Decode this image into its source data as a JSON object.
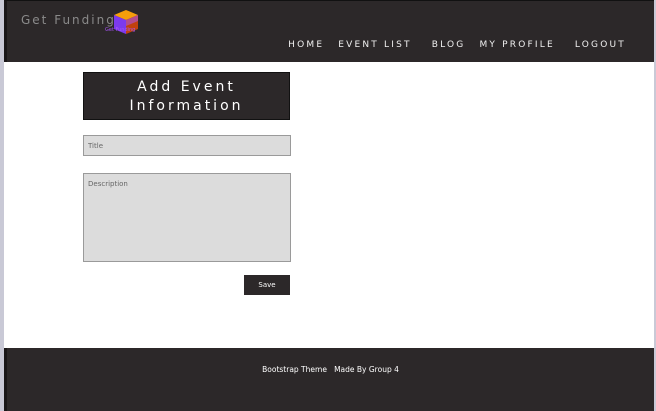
{
  "header": {
    "brand": "Get Funding",
    "logo_text": "Get Funding",
    "nav": [
      {
        "label": "HOME"
      },
      {
        "label": "EVENT LIST"
      },
      {
        "label": "BLOG"
      },
      {
        "label": "MY PROFILE"
      },
      {
        "label": "LOGOUT"
      }
    ]
  },
  "form": {
    "title_line1": "Add Event",
    "title_line2": "Information",
    "title_placeholder": "Title",
    "description_placeholder": "Description",
    "save_label": "Save"
  },
  "footer": {
    "text": "Bootstrap Theme   Made By Group 4"
  },
  "colors": {
    "dark": "#2c2829",
    "input_bg": "#dcdcdc",
    "logo_purple": "#a855f7",
    "logo_orange": "#f59e0b"
  },
  "icons": {
    "logo": "cube-logo-icon"
  }
}
